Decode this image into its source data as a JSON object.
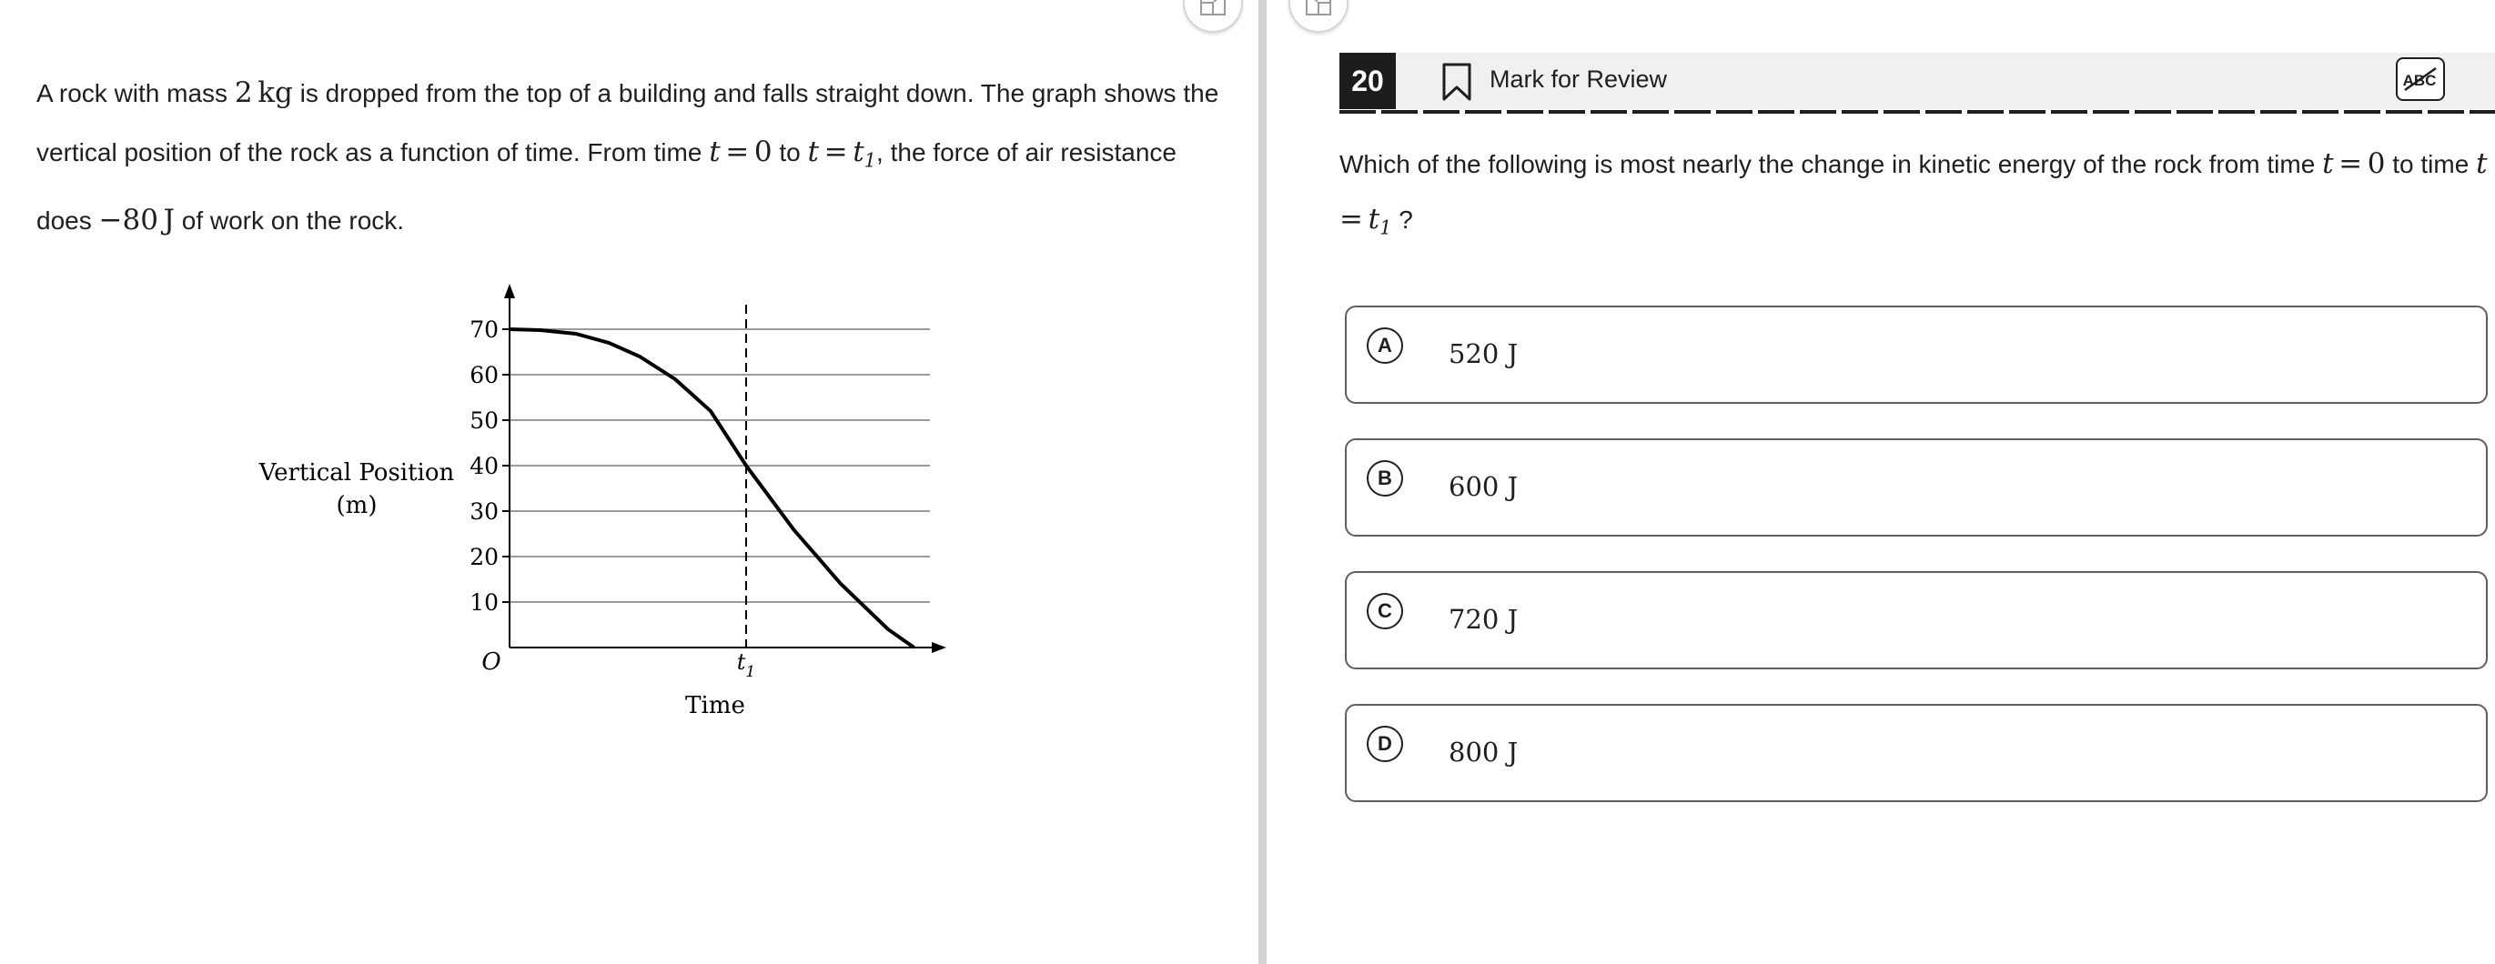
{
  "passage": {
    "t1": "A rock with mass ",
    "mass_num": "2",
    "mass_unit": "kg",
    "t2": " is dropped from the top of a building and falls straight down. The graph shows the vertical position of the rock as a function of time. From time ",
    "var_t": "t",
    "eq": "=",
    "zero": "0",
    "to": " to ",
    "t1_base": "t",
    "t1_sub": "1",
    "t3": ", the force of air resistance does ",
    "work_val": "−80",
    "work_unit": "J",
    "t4": " of work on the rock."
  },
  "graph": {
    "ylabel_line1": "Vertical Position",
    "ylabel_line2": "(m)",
    "xlabel": "Time",
    "origin": "O",
    "t1_label_base": "t",
    "t1_label_sub": "1",
    "yticks": [
      "70",
      "60",
      "50",
      "40",
      "30",
      "20",
      "10"
    ]
  },
  "chart_data": {
    "type": "line",
    "xlabel": "Time",
    "ylabel": "Vertical Position (m)",
    "ylim": [
      0,
      70
    ],
    "yticks": [
      10,
      20,
      30,
      40,
      50,
      60,
      70
    ],
    "markers": [
      {
        "label": "t1",
        "x": 1
      }
    ],
    "series": [
      {
        "x": [
          0,
          0.13,
          0.28,
          0.42,
          0.55,
          0.7,
          0.85,
          1.0,
          1.2,
          1.4,
          1.6,
          1.71
        ],
        "y": [
          70,
          69.8,
          69,
          67,
          64,
          59,
          52,
          40,
          26,
          14,
          4,
          0
        ]
      }
    ],
    "grid": true
  },
  "question": {
    "number": "20",
    "mark_label": "Mark for Review",
    "abc_label": "ABC",
    "text_before": "Which of the following is most nearly the change in kinetic energy of the rock from time ",
    "var_t": "t",
    "eq": "=",
    "zero": "0",
    "to_time": " to time ",
    "t1_base": "t",
    "t1_sub": "1",
    "end": " ?"
  },
  "choices": [
    {
      "letter": "A",
      "text": "520 J"
    },
    {
      "letter": "B",
      "text": "600 J"
    },
    {
      "letter": "C",
      "text": "720 J"
    },
    {
      "letter": "D",
      "text": "800 J"
    }
  ]
}
